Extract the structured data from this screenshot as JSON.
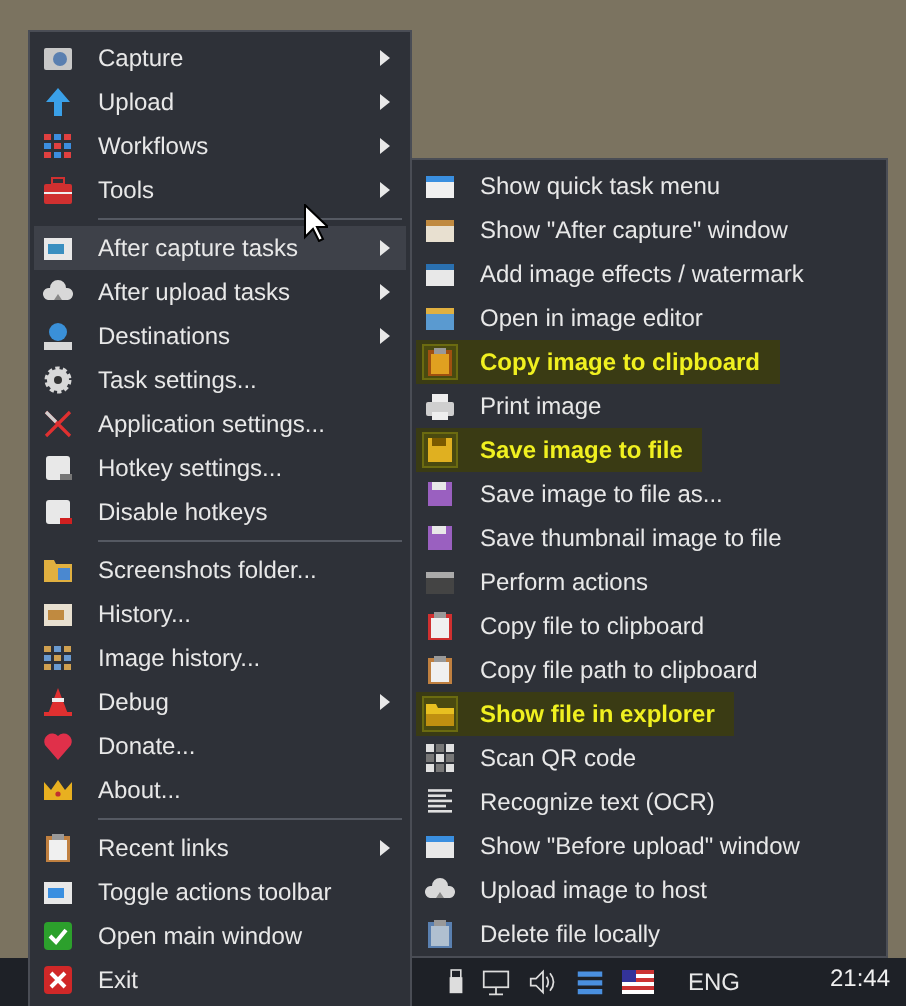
{
  "main_menu": {
    "items": [
      {
        "kind": "item",
        "label": "Capture",
        "has_submenu": true,
        "selected": false
      },
      {
        "kind": "item",
        "label": "Upload",
        "has_submenu": true,
        "selected": false
      },
      {
        "kind": "item",
        "label": "Workflows",
        "has_submenu": true,
        "selected": false
      },
      {
        "kind": "item",
        "label": "Tools",
        "has_submenu": true,
        "selected": false
      },
      {
        "kind": "separator"
      },
      {
        "kind": "item",
        "label": "After capture tasks",
        "has_submenu": true,
        "selected": true
      },
      {
        "kind": "item",
        "label": "After upload tasks",
        "has_submenu": true,
        "selected": false
      },
      {
        "kind": "item",
        "label": "Destinations",
        "has_submenu": true,
        "selected": false
      },
      {
        "kind": "item",
        "label": "Task settings...",
        "has_submenu": false,
        "selected": false
      },
      {
        "kind": "item",
        "label": "Application settings...",
        "has_submenu": false,
        "selected": false
      },
      {
        "kind": "item",
        "label": "Hotkey settings...",
        "has_submenu": false,
        "selected": false
      },
      {
        "kind": "item",
        "label": "Disable hotkeys",
        "has_submenu": false,
        "selected": false
      },
      {
        "kind": "separator"
      },
      {
        "kind": "item",
        "label": "Screenshots folder...",
        "has_submenu": false,
        "selected": false
      },
      {
        "kind": "item",
        "label": "History...",
        "has_submenu": false,
        "selected": false
      },
      {
        "kind": "item",
        "label": "Image history...",
        "has_submenu": false,
        "selected": false
      },
      {
        "kind": "item",
        "label": "Debug",
        "has_submenu": true,
        "selected": false
      },
      {
        "kind": "item",
        "label": "Donate...",
        "has_submenu": false,
        "selected": false
      },
      {
        "kind": "item",
        "label": "About...",
        "has_submenu": false,
        "selected": false
      },
      {
        "kind": "separator"
      },
      {
        "kind": "item",
        "label": "Recent links",
        "has_submenu": true,
        "selected": false
      },
      {
        "kind": "item",
        "label": "Toggle actions toolbar",
        "has_submenu": false,
        "selected": false
      },
      {
        "kind": "item",
        "label": "Open main window",
        "has_submenu": false,
        "selected": false
      },
      {
        "kind": "item",
        "label": "Exit",
        "has_submenu": false,
        "selected": false
      }
    ]
  },
  "submenu": {
    "items": [
      {
        "label": "Show quick task menu",
        "checked": false
      },
      {
        "label": "Show \"After capture\" window",
        "checked": false
      },
      {
        "label": "Add image effects / watermark",
        "checked": false
      },
      {
        "label": "Open in image editor",
        "checked": false
      },
      {
        "label": "Copy image to clipboard",
        "checked": true
      },
      {
        "label": "Print image",
        "checked": false
      },
      {
        "label": "Save image to file",
        "checked": true
      },
      {
        "label": "Save image to file as...",
        "checked": false
      },
      {
        "label": "Save thumbnail image to file",
        "checked": false
      },
      {
        "label": "Perform actions",
        "checked": false
      },
      {
        "label": "Copy file to clipboard",
        "checked": false
      },
      {
        "label": "Copy file path to clipboard",
        "checked": false
      },
      {
        "label": "Show file in explorer",
        "checked": true
      },
      {
        "label": "Scan QR code",
        "checked": false
      },
      {
        "label": "Recognize text (OCR)",
        "checked": false
      },
      {
        "label": "Show \"Before upload\" window",
        "checked": false
      },
      {
        "label": "Upload image to host",
        "checked": false
      },
      {
        "label": "Delete file locally",
        "checked": false
      }
    ]
  },
  "taskbar": {
    "language": "ENG",
    "clock": "21:44"
  }
}
